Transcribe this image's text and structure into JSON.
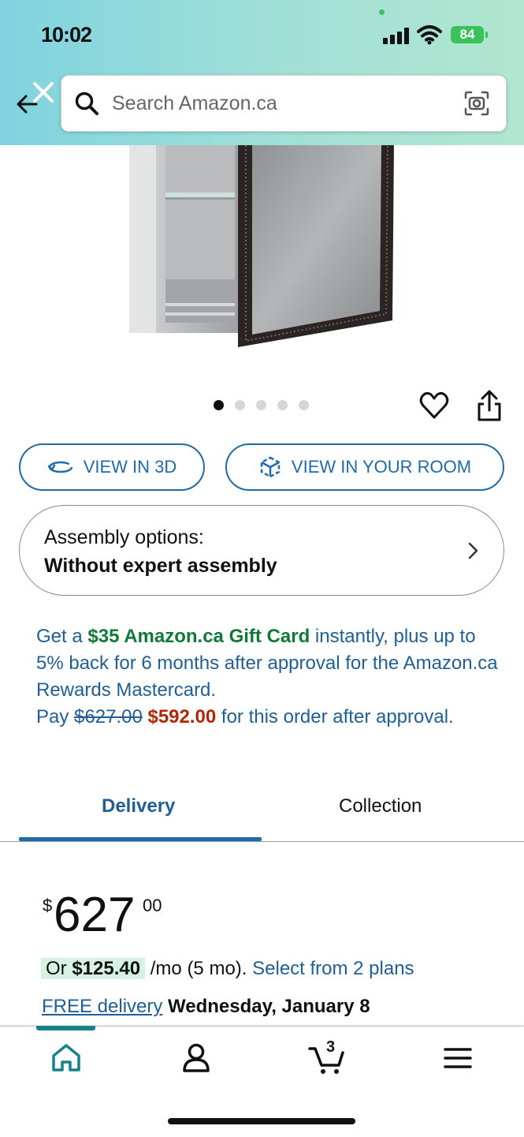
{
  "status_bar": {
    "time": "10:02",
    "battery": "84"
  },
  "search": {
    "placeholder": "Search Amazon.ca"
  },
  "product": {
    "image_count": 5,
    "active_image_index": 0
  },
  "buttons": {
    "view_3d": "VIEW IN 3D",
    "view_room": "VIEW IN YOUR ROOM"
  },
  "assembly": {
    "label": "Assembly options:",
    "value": "Without expert assembly"
  },
  "promo": {
    "prefix": "Get a ",
    "gift_card": "$35 Amazon.ca Gift Card",
    "middle": " instantly, plus up to 5% back for 6 months after approval for the Amazon.ca Rewards Mastercard.",
    "pay_label": "Pay ",
    "original_price": "$627.00",
    "discounted_price": "$592.00",
    "suffix": " for this order after approval."
  },
  "tabs": {
    "delivery": "Delivery",
    "collection": "Collection"
  },
  "price": {
    "currency": "$",
    "whole": "627",
    "fraction": "00"
  },
  "monthly": {
    "or": "Or ",
    "amount": "$125.40",
    "term": " /mo (5 mo). ",
    "link": "Select from 2 plans"
  },
  "delivery": {
    "free": "FREE delivery",
    "date": "Wednesday, January 8"
  },
  "bottom_nav": {
    "cart_count": "3",
    "items": [
      "home-icon",
      "account-icon",
      "cart-icon",
      "menu-icon"
    ]
  },
  "colors": {
    "link_blue": "#1f5f96",
    "green": "#0f7a38",
    "deal_red": "#b12704",
    "accent_teal": "#16838c"
  }
}
